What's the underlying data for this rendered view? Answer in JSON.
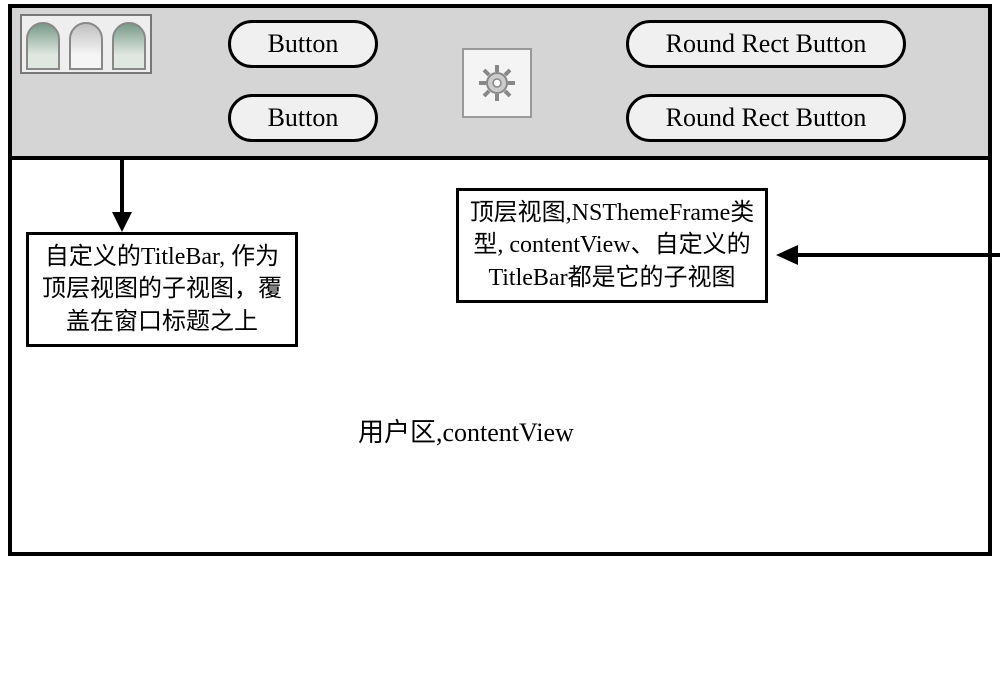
{
  "titlebar": {
    "button1_label": "Button",
    "button2_label": "Button",
    "button3_label": "Round Rect Button",
    "button4_label": "Round Rect Button"
  },
  "annotations": {
    "left_box": "自定义的TitleBar, 作为顶层视图的子视图，覆盖在窗口标题之上",
    "right_box": "顶层视图,NSThemeFrame类型, contentView、自定义的TitleBar都是它的子视图"
  },
  "content_label": "用户区,contentView"
}
